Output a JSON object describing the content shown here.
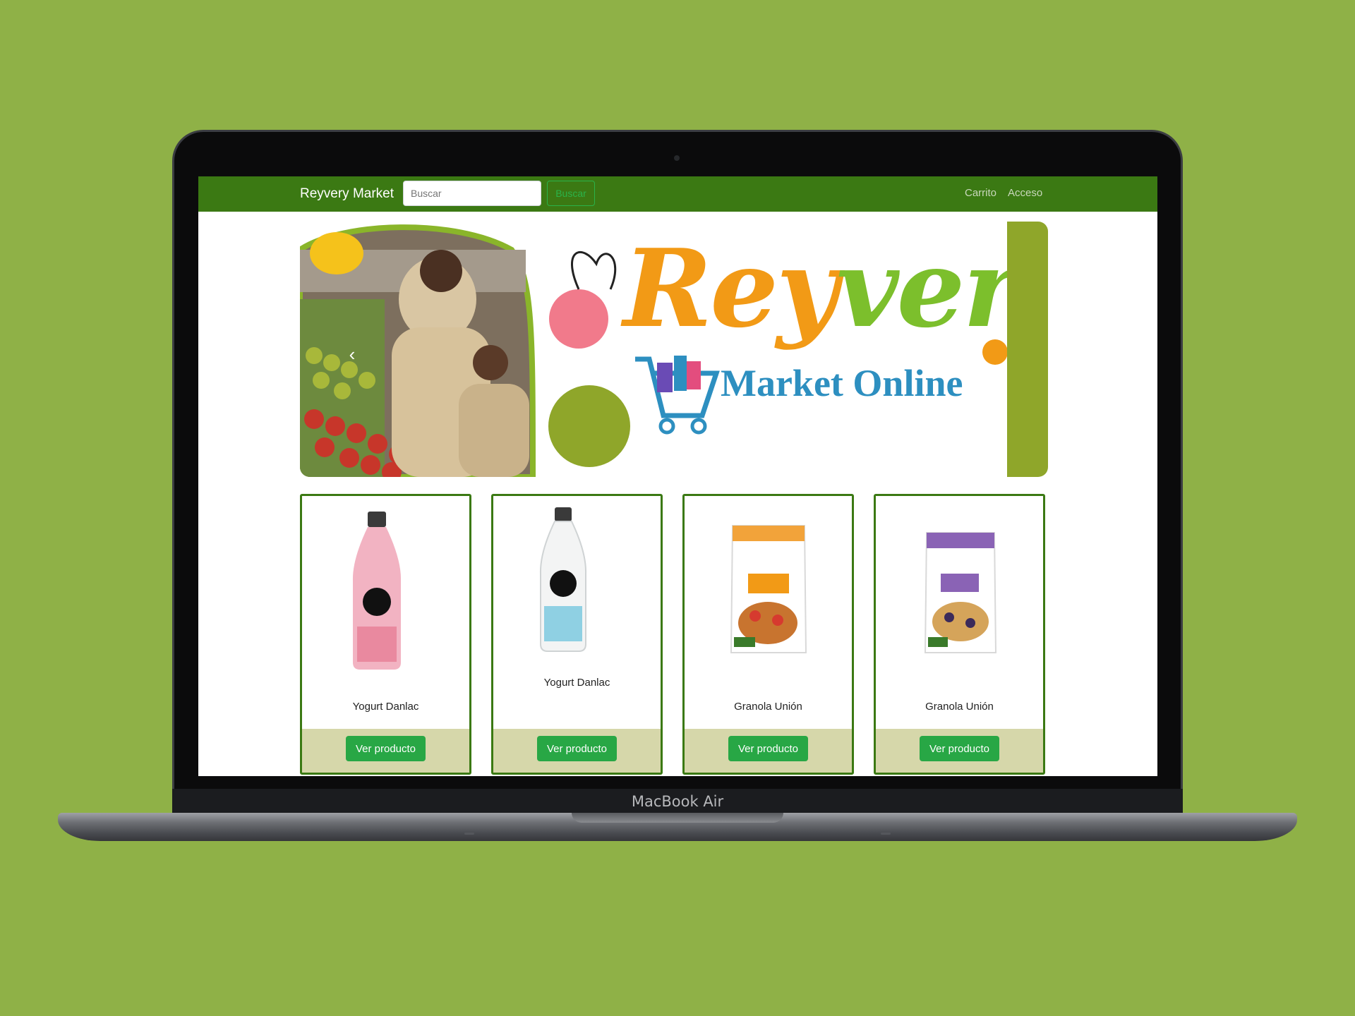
{
  "device": {
    "label": "MacBook Air"
  },
  "navbar": {
    "brand": "Reyvery Market",
    "search_placeholder": "Buscar",
    "search_button": "Buscar",
    "links": [
      "Carrito",
      "Acceso"
    ]
  },
  "banner": {
    "logo_title_part1": "Rey",
    "logo_title_part2": "very",
    "logo_subtitle": "Market Online"
  },
  "products": [
    {
      "name": "Yogurt Danlac",
      "button": "Ver producto"
    },
    {
      "name": "Yogurt Danlac",
      "button": "Ver producto"
    },
    {
      "name": "Granola Unión",
      "button": "Ver producto"
    },
    {
      "name": "Granola Unión",
      "button": "Ver producto"
    }
  ],
  "colors": {
    "background": "#8fb147",
    "navbar": "#3b7913",
    "button": "#28a745",
    "card_footer": "#d6d7aa",
    "logo_orange": "#f29a16",
    "logo_green": "#7cbf2c",
    "logo_blue": "#2d8fc0"
  }
}
